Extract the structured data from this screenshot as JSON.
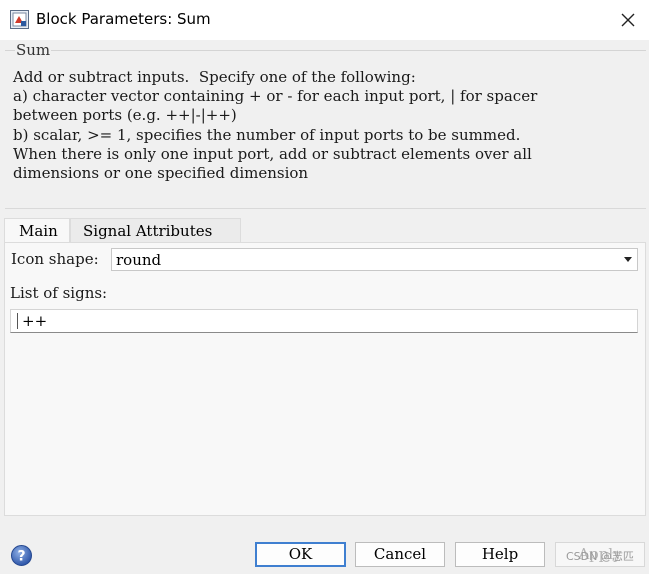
{
  "window": {
    "title": "Block Parameters: Sum",
    "icon": "simulink-block-icon",
    "close_icon": "close-icon"
  },
  "group": {
    "legend": "Sum",
    "description": "Add or subtract inputs.  Specify one of the following:\na) character vector containing + or - for each input port, | for spacer\nbetween ports (e.g. ++|-|++)\nb) scalar, >= 1, specifies the number of input ports to be summed.\nWhen there is only one input port, add or subtract elements over all\ndimensions or one specified dimension"
  },
  "tabs": [
    {
      "label": "Main",
      "active": true
    },
    {
      "label": "Signal Attributes",
      "active": false
    }
  ],
  "main": {
    "icon_shape_label": "Icon shape:",
    "icon_shape_value": "round",
    "list_of_signs_label": "List of signs:",
    "list_of_signs_value": "++"
  },
  "buttons": {
    "ok": "OK",
    "cancel": "Cancel",
    "help": "Help",
    "apply": "Apply"
  },
  "footer": {
    "help_icon": "help-icon",
    "watermark": "CSDN @志匹"
  }
}
